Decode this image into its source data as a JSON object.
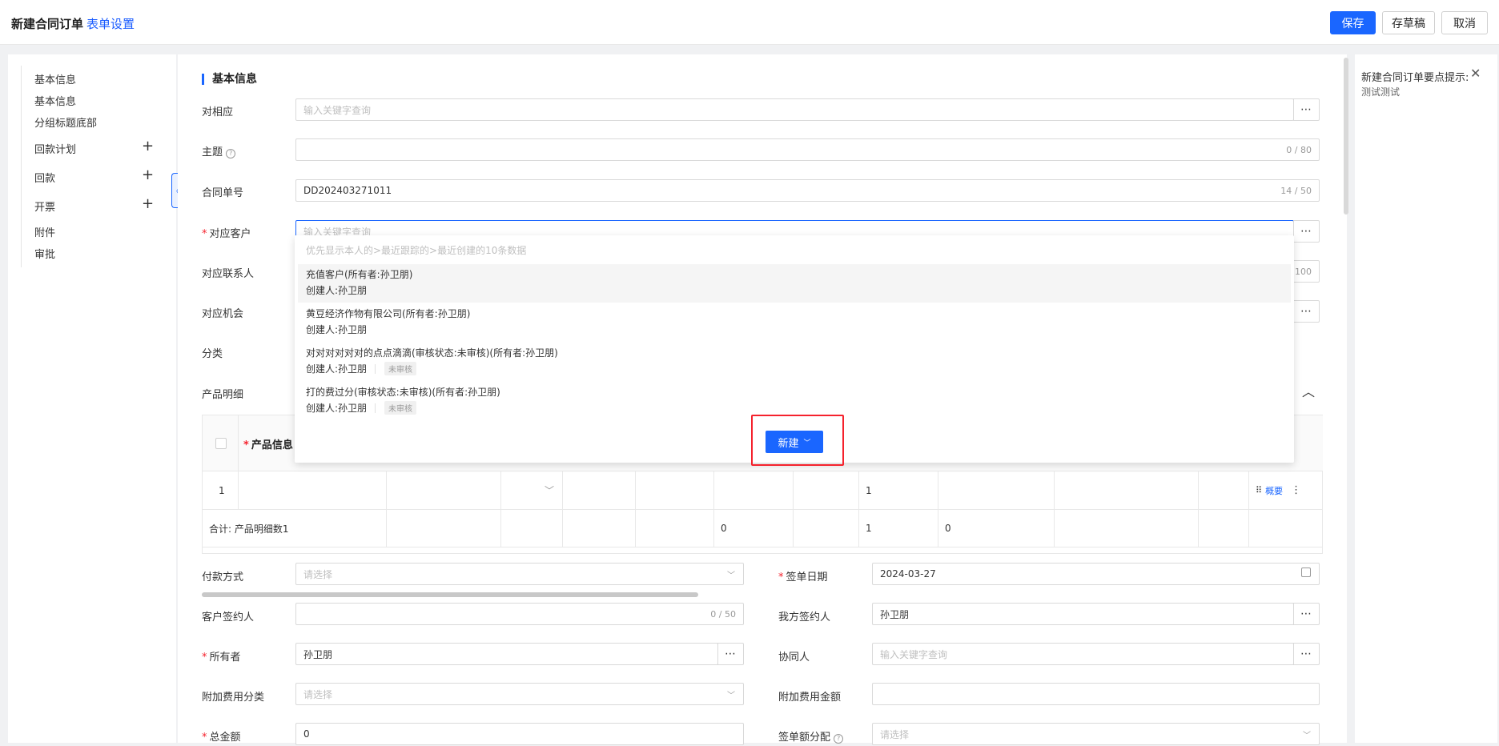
{
  "header": {
    "title": "新建合同订单",
    "setting_link": "表单设置",
    "save": "保存",
    "draft": "存草稿",
    "cancel": "取消"
  },
  "sidebar": {
    "items": [
      {
        "label": "基本信息",
        "plus": false
      },
      {
        "label": "基本信息",
        "plus": false
      },
      {
        "label": "分组标题底部",
        "plus": false
      },
      {
        "label": "回款计划",
        "plus": true
      },
      {
        "label": "回款",
        "plus": true
      },
      {
        "label": "开票",
        "plus": true
      },
      {
        "label": "附件",
        "plus": false
      },
      {
        "label": "审批",
        "plus": false
      }
    ],
    "plus_glyph": "+"
  },
  "right_panel": {
    "title": "新建合同订单要点提示:",
    "text": "测试测试"
  },
  "form": {
    "section_title": "基本信息",
    "required_mark": "*",
    "dots": "⋯",
    "fields": {
      "dui_ying": {
        "label": "对相应",
        "placeholder": "输入关键字查询"
      },
      "subject": {
        "label": "主题",
        "help": "?",
        "counter": "0 / 80"
      },
      "contract_no": {
        "label": "合同单号",
        "value": "DD202403271011",
        "counter": "14 / 50"
      },
      "customer": {
        "label": "对应客户",
        "placeholder": "输入关键字查询"
      },
      "contact": {
        "label": "对应联系人",
        "counter": "100"
      },
      "opportunity": {
        "label": "对应机会"
      },
      "category": {
        "label": "分类"
      },
      "product_detail": {
        "label": "产品明细"
      },
      "payment_method": {
        "label": "付款方式",
        "placeholder": "请选择"
      },
      "sign_date": {
        "label": "签单日期",
        "value": "2024-03-27"
      },
      "customer_signer": {
        "label": "客户签约人",
        "counter": "0 / 50"
      },
      "our_signer": {
        "label": "我方签约人",
        "value": "孙卫朋"
      },
      "owner": {
        "label": "所有者",
        "value": "孙卫朋"
      },
      "collaborator": {
        "label": "协同人",
        "placeholder": "输入关键字查询"
      },
      "extra_fee_category": {
        "label": "附加费用分类",
        "placeholder": "请选择"
      },
      "extra_fee_amount": {
        "label": "附加费用金额"
      },
      "total_amount": {
        "label": "总金额",
        "value": "0"
      },
      "order_allocation": {
        "label": "签单额分配",
        "help": "?",
        "placeholder": "请选择"
      }
    }
  },
  "table": {
    "header_product": "产品信息",
    "row": {
      "index": "1",
      "qty": "1",
      "action": "概要"
    },
    "total": {
      "label": "合计:  产品明细数1",
      "v1": "0",
      "v2": "1",
      "v3": "0"
    }
  },
  "dropdown": {
    "hint": "优先显示本人的>最近跟踪的>最近创建的10条数据",
    "items": [
      {
        "name": "充值客户(所有者:孙卫朋)",
        "creator": "创建人:孙卫朋",
        "badge": ""
      },
      {
        "name": "黄豆经济作物有限公司(所有者:孙卫朋)",
        "creator": "创建人:孙卫朋",
        "badge": ""
      },
      {
        "name": "对对对对对对的点点滴滴(审核状态:未审核)(所有者:孙卫朋)",
        "creator": "创建人:孙卫朋",
        "badge": "未审核"
      },
      {
        "name": "打的费过分(审核状态:未审核)(所有者:孙卫朋)",
        "creator": "创建人:孙卫朋",
        "badge": "未审核"
      }
    ],
    "new_button": "新建"
  }
}
